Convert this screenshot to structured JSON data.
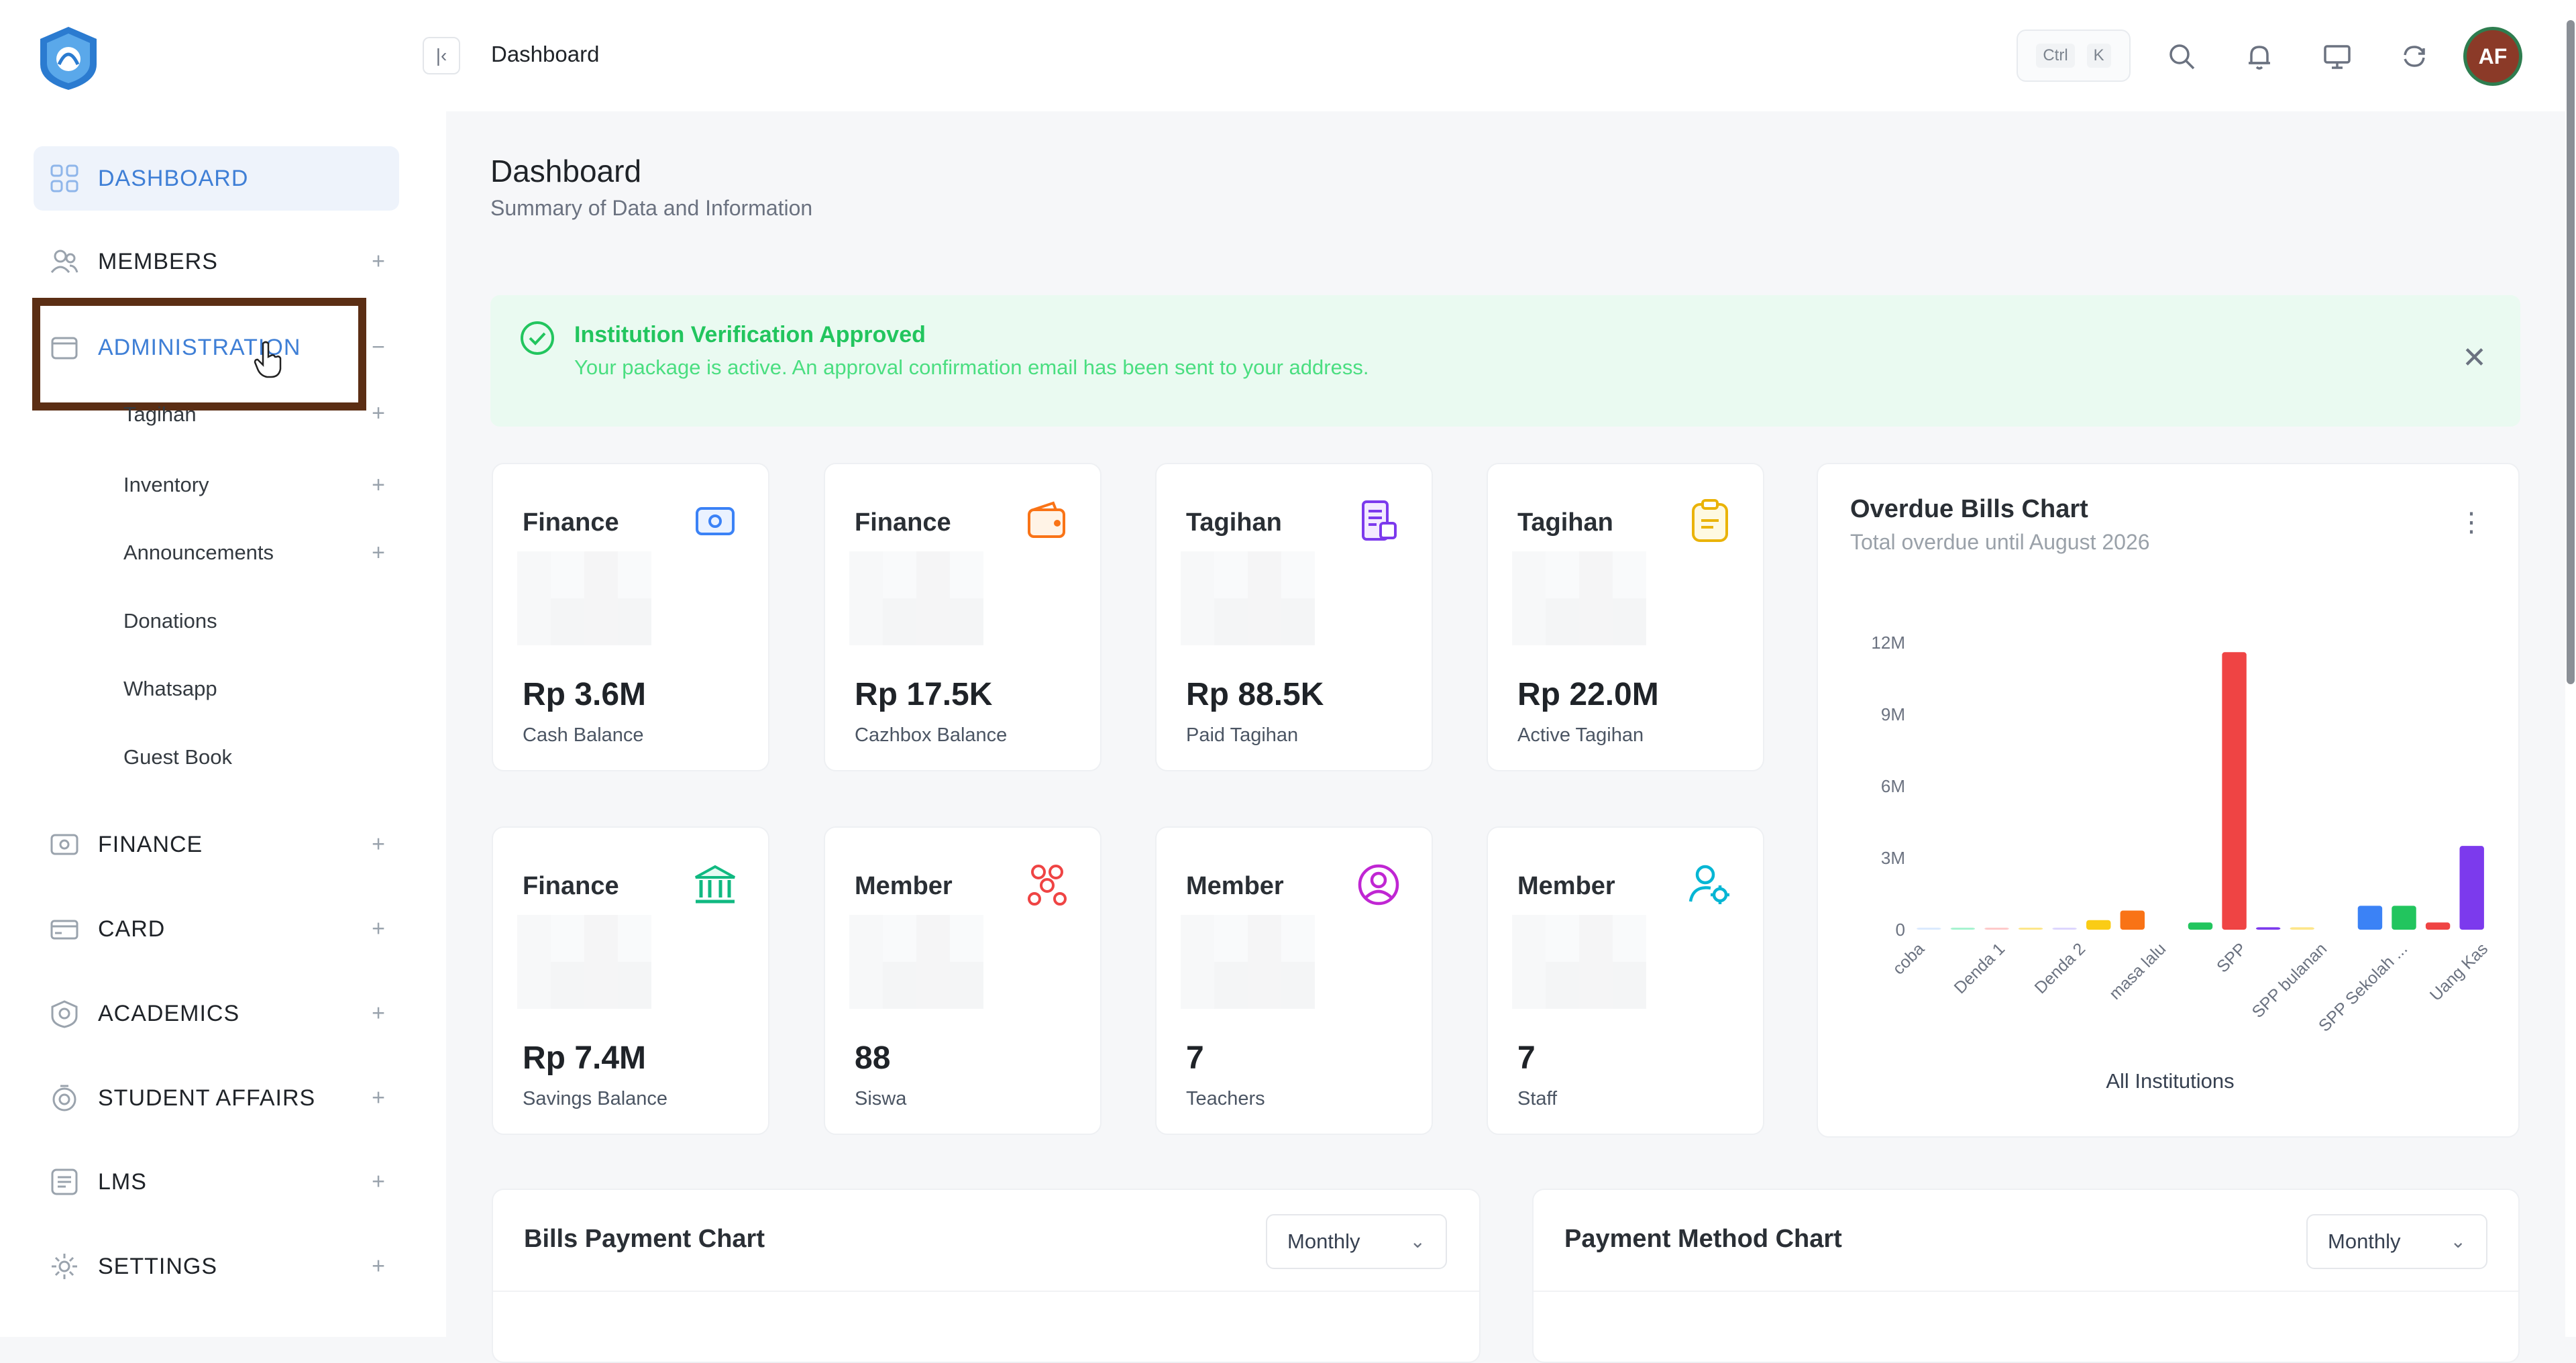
{
  "app": {
    "title": "Dashboard"
  },
  "sidebar": {
    "items": [
      {
        "label": "DASHBOARD",
        "icon": "grid-icon"
      },
      {
        "label": "MEMBERS",
        "icon": "users-icon"
      },
      {
        "label": "ADMINISTRATION",
        "icon": "folder-icon"
      },
      {
        "label": "FINANCE",
        "icon": "wallet-icon"
      },
      {
        "label": "CARD",
        "icon": "card-icon"
      },
      {
        "label": "ACADEMICS",
        "icon": "academics-icon"
      },
      {
        "label": "STUDENT AFFAIRS",
        "icon": "student-icon"
      },
      {
        "label": "LMS",
        "icon": "lms-icon"
      },
      {
        "label": "SETTINGS",
        "icon": "gear-icon"
      }
    ],
    "sub_items": [
      {
        "label": "Tagihan"
      },
      {
        "label": "Inventory"
      },
      {
        "label": "Announcements"
      },
      {
        "label": "Donations"
      },
      {
        "label": "Whatsapp"
      },
      {
        "label": "Guest Book"
      }
    ]
  },
  "topbar": {
    "breadcrumb": "Dashboard",
    "shortcut_ctrl": "Ctrl",
    "shortcut_key": "K",
    "avatar_initials": "AF"
  },
  "header": {
    "title": "Dashboard",
    "subtitle": "Summary of Data and Information"
  },
  "alert": {
    "title": "Institution Verification Approved",
    "message": "Your package is active. An approval confirmation email has been sent to your address."
  },
  "cards": [
    {
      "label": "Finance",
      "value": "Rp 3.6M",
      "sub": "Cash Balance",
      "icon": "cash-icon",
      "color": "#3b82f6"
    },
    {
      "label": "Finance",
      "value": "Rp 17.5K",
      "sub": "Cazhbox Balance",
      "icon": "wallet-icon",
      "color": "#f97316"
    },
    {
      "label": "Tagihan",
      "value": "Rp 88.5K",
      "sub": "Paid Tagihan",
      "icon": "receipt-icon",
      "color": "#7c3aed"
    },
    {
      "label": "Tagihan",
      "value": "Rp 22.0M",
      "sub": "Active Tagihan",
      "icon": "clipboard-icon",
      "color": "#eab308"
    },
    {
      "label": "Finance",
      "value": "Rp 7.4M",
      "sub": "Savings Balance",
      "icon": "bank-icon",
      "color": "#10b981"
    },
    {
      "label": "Member",
      "value": "88",
      "sub": "Siswa",
      "icon": "group-icon",
      "color": "#ef4444"
    },
    {
      "label": "Member",
      "value": "7",
      "sub": "Teachers",
      "icon": "user-circle-icon",
      "color": "#c026d3"
    },
    {
      "label": "Member",
      "value": "7",
      "sub": "Staff",
      "icon": "user-settings-icon",
      "color": "#06b6d4"
    }
  ],
  "overdue_chart": {
    "title": "Overdue Bills Chart",
    "subtitle": "Total overdue until August 2026",
    "xlabel": "All Institutions"
  },
  "chart_data": {
    "type": "bar",
    "title": "Overdue Bills Chart",
    "subtitle": "Total overdue until August 2026",
    "xlabel": "All Institutions",
    "ylabel": "",
    "ylim": [
      0,
      12000000
    ],
    "yticks": [
      "0",
      "3M",
      "6M",
      "9M",
      "12M"
    ],
    "x_tick_labels": [
      "coba",
      "Denda 1",
      "Denda 2",
      "masa lalu",
      "SPP",
      "SPP bulanan",
      "SPP Sekolah ...",
      "Uang Kas"
    ],
    "values": [
      50000,
      50000,
      50000,
      50000,
      50000,
      400000,
      800000,
      0,
      300000,
      11600000,
      100000,
      100000,
      0,
      1000000,
      1000000,
      300000,
      3500000
    ],
    "colors": [
      "#dbeafe",
      "#a7f3d0",
      "#fecaca",
      "#fde68a",
      "#ddd6fe",
      "#facc15",
      "#f97316",
      "#e5e7eb",
      "#22c55e",
      "#ef4444",
      "#7c3aed",
      "#fde68a",
      "#e5e7eb",
      "#3b82f6",
      "#22c55e",
      "#ef4444",
      "#7c3aed"
    ]
  },
  "bills_payment": {
    "title": "Bills Payment Chart",
    "period": "Monthly"
  },
  "payment_method": {
    "title": "Payment Method Chart",
    "period": "Monthly"
  }
}
